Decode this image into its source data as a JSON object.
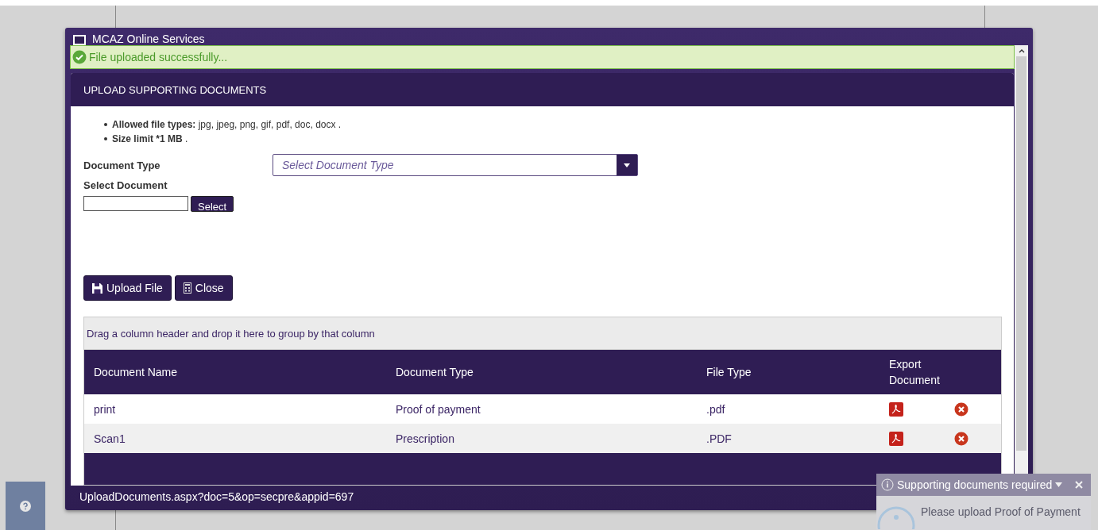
{
  "window": {
    "title": "MCAZ Online Services"
  },
  "banner": {
    "message": "File uploaded successfully..."
  },
  "panel": {
    "title": "UPLOAD SUPPORTING DOCUMENTS"
  },
  "rules": [
    "**Allowed file types:** jpg, jpeg, png, gif, pdf, doc, docx .",
    "**Size limit *1 MB** ."
  ],
  "form": {
    "document_type_label": "Document Type",
    "document_type_placeholder": "Select Document Type",
    "select_document_label": "Select Document",
    "select_button": "Select"
  },
  "buttons": [
    {
      "kind": "upload",
      "label": "Upload File"
    },
    {
      "kind": "close",
      "label": "Close"
    }
  ],
  "grid": {
    "group_hint": "Drag a column header and drop it here to group by that column",
    "columns": [
      "Document Name",
      "Document Type",
      "File Type",
      "Export Document"
    ],
    "rows": [
      {
        "name": "print",
        "type": "Proof of payment",
        "file_type": ".pdf"
      },
      {
        "name": "Scan1",
        "type": "Prescription",
        "file_type": ".PDF"
      }
    ]
  },
  "status_bar": {
    "url": "UploadDocuments.aspx?doc=5&op=secpre&appid=697"
  },
  "toast": {
    "title": "Supporting documents required",
    "message": "Please upload Proof of Payment"
  }
}
